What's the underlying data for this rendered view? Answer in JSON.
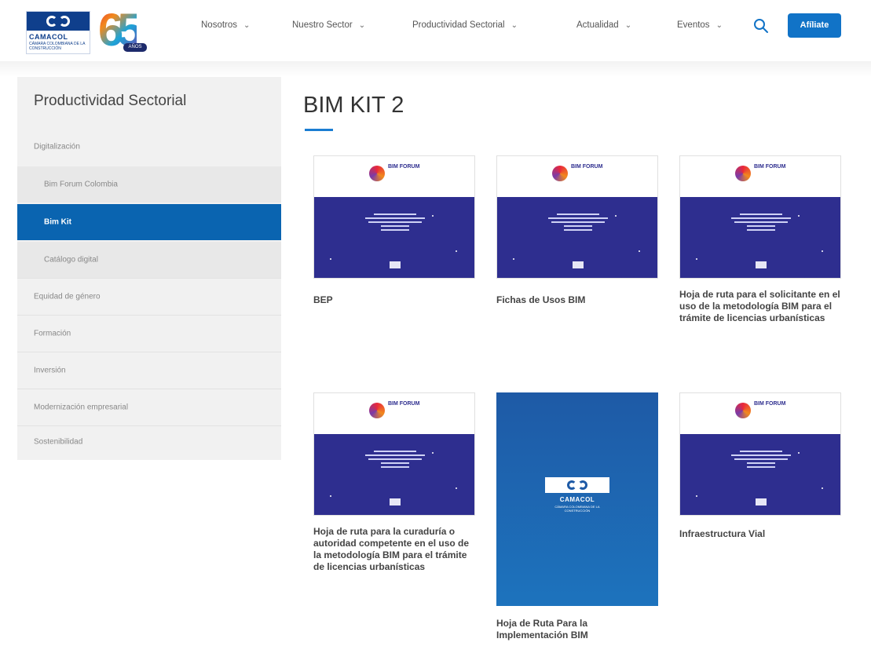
{
  "brand": {
    "logo_name": "CAMACOL",
    "logo_sub": "CÁMARA COLOMBIANA DE LA CONSTRUCCIÓN",
    "anniversary": "65",
    "anniversary_tag": "AÑOS"
  },
  "nav": {
    "items": [
      {
        "label": "Nosotros"
      },
      {
        "label": "Nuestro Sector"
      },
      {
        "label": "Productividad Sectorial"
      },
      {
        "label": "Actualidad"
      },
      {
        "label": "Eventos"
      }
    ],
    "chevron_icon": "chevron-down-icon",
    "search_icon": "search-icon",
    "cta_label": "Afíliate",
    "cta_color": "#1173c7"
  },
  "sidebar": {
    "title": "Productividad Sectorial",
    "items": [
      {
        "label": "Digitalización",
        "level": 1
      },
      {
        "label": "Bim Forum Colombia",
        "level": 2
      },
      {
        "label": "Bim Kit",
        "level": 2,
        "active": true
      },
      {
        "label": "Catálogo digital",
        "level": 2
      },
      {
        "label": "Equidad de género",
        "level": 1
      },
      {
        "label": "Formación",
        "level": 1
      },
      {
        "label": "Inversión",
        "level": 1
      },
      {
        "label": "Modernización empresarial",
        "level": 1
      },
      {
        "label": "Sostenibilidad",
        "level": 1
      }
    ],
    "active_color": "#0a64b0"
  },
  "main": {
    "title": "BIM KIT 2",
    "accent_color": "#1a7dd2",
    "cards": [
      {
        "title": "BEP",
        "thumb_text": "BIM FORUM"
      },
      {
        "title": "Fichas de Usos BIM",
        "thumb_text": "BIM FORUM"
      },
      {
        "title": "Hoja de ruta para el solicitante en el uso de la metodología BIM para el trámite de licencias urbanísticas",
        "thumb_text": "BIM FORUM"
      },
      {
        "title": "Hoja de ruta para la curaduría o autoridad competente en el uso de la metodología BIM para el trámite de licencias urbanísticas",
        "thumb_text": "BIM FORUM"
      },
      {
        "title": "Hoja de Ruta Para la Implementación BIM",
        "thumb_text": "CAMACOL",
        "thumb_sub": "CÁMARA COLOMBIANA DE LA CONSTRUCCIÓN"
      },
      {
        "title": "Infraestructura Vial",
        "thumb_text": "BIM FORUM"
      }
    ]
  }
}
